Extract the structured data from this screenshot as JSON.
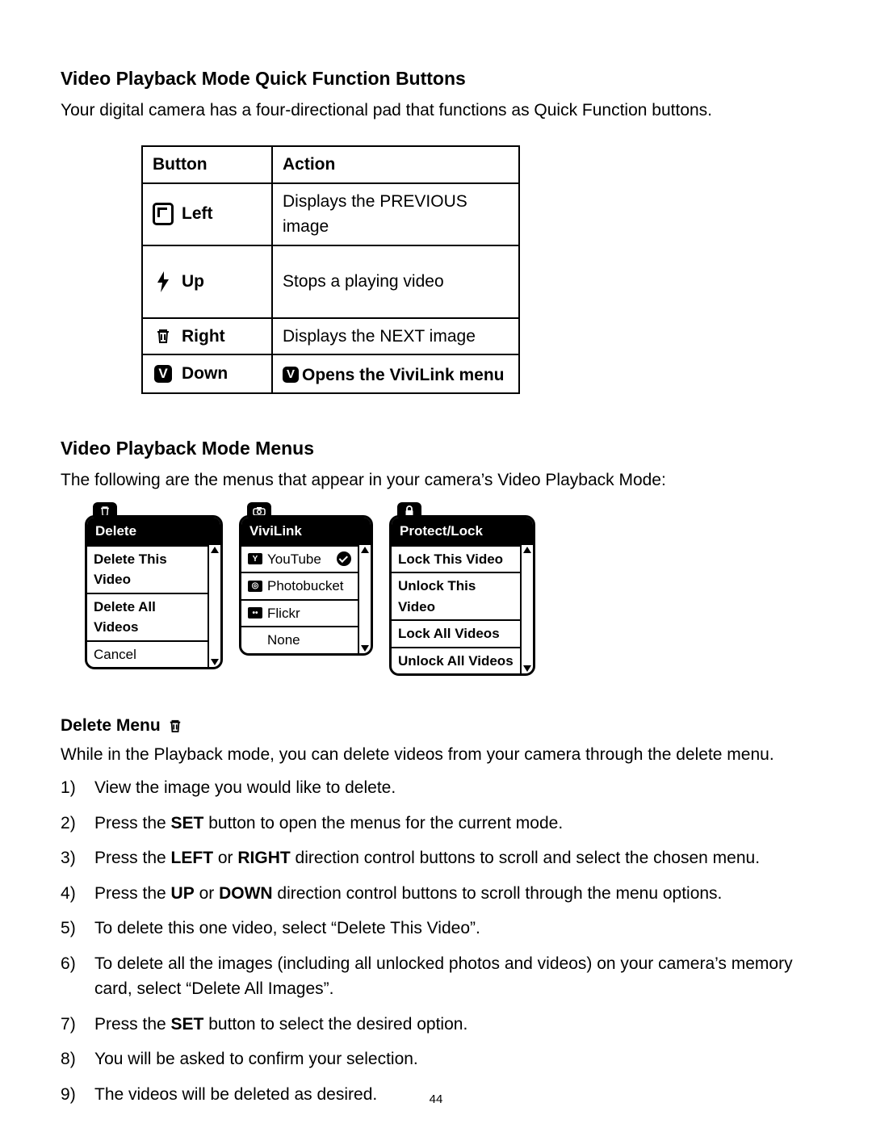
{
  "section1": {
    "title": "Video Playback Mode Quick Function Buttons",
    "intro": "Your digital camera has a four-directional pad that functions as Quick Function buttons.",
    "table": {
      "head_button": "Button",
      "head_action": "Action",
      "rows": [
        {
          "icon": "multi-frame-icon",
          "label": "Left",
          "action": "Displays the PREVIOUS image",
          "bold_action": false,
          "action_icon": null
        },
        {
          "icon": "bolt-icon",
          "label": "Up",
          "action": "Stops a playing video",
          "bold_action": false,
          "action_icon": null
        },
        {
          "icon": "trash-icon",
          "label": "Right",
          "action": "Displays the NEXT image",
          "bold_action": false,
          "action_icon": null
        },
        {
          "icon": "vivilink-v-icon",
          "label": "Down",
          "action": "Opens the ViviLink menu",
          "bold_action": true,
          "action_icon": "vivilink-v-icon"
        }
      ]
    }
  },
  "section2": {
    "title": "Video Playback Mode Menus",
    "intro": "The following are the menus that appear in your camera’s Video Playback Mode:",
    "menus": {
      "delete": {
        "tab_icon": "trash-icon",
        "header": "Delete",
        "items": [
          {
            "label": "Delete This Video",
            "bold": true
          },
          {
            "label": "Delete All Videos",
            "bold": true
          },
          {
            "label": "Cancel",
            "bold": false
          }
        ]
      },
      "vivilink": {
        "tab_icon": "camera-icon",
        "header": "ViviLink",
        "items": [
          {
            "icon": "youtube-icon",
            "label": "YouTube",
            "checked": true
          },
          {
            "icon": "photobucket-icon",
            "label": "Photobucket",
            "checked": false
          },
          {
            "icon": "flickr-icon",
            "label": "Flickr",
            "checked": false
          },
          {
            "icon": null,
            "label": "None",
            "checked": false
          }
        ]
      },
      "protect": {
        "tab_icon": "lock-icon",
        "header": "Protect/Lock",
        "items": [
          {
            "label": "Lock This Video"
          },
          {
            "label": "Unlock This Video"
          },
          {
            "label": "Lock All Videos"
          },
          {
            "label": "Unlock All Videos"
          }
        ]
      }
    }
  },
  "section3": {
    "title": "Delete Menu",
    "icon": "trash-icon",
    "intro": "While in the Playback mode, you can delete videos from your camera through the delete menu.",
    "steps": [
      [
        {
          "t": "View the image you would like to delete."
        }
      ],
      [
        {
          "t": "Press the "
        },
        {
          "b": "SET"
        },
        {
          "t": " button to open the menus for the current mode."
        }
      ],
      [
        {
          "t": "Press the "
        },
        {
          "b": "LEFT"
        },
        {
          "t": " or "
        },
        {
          "b": "RIGHT"
        },
        {
          "t": " direction control buttons to scroll and select the chosen menu."
        }
      ],
      [
        {
          "t": "Press the "
        },
        {
          "b": "UP"
        },
        {
          "t": " or "
        },
        {
          "b": "DOWN"
        },
        {
          "t": " direction control buttons to scroll through the menu options."
        }
      ],
      [
        {
          "t": "To delete this one video, select “Delete This Video”."
        }
      ],
      [
        {
          "t": "To delete all the images (including all unlocked photos and videos) on your camera’s memory card, select “Delete All Images”."
        }
      ],
      [
        {
          "t": "Press the "
        },
        {
          "b": "SET"
        },
        {
          "t": " button to select the desired option."
        }
      ],
      [
        {
          "t": "You will be asked to confirm your selection."
        }
      ],
      [
        {
          "t": "The videos will be deleted as desired."
        }
      ]
    ]
  },
  "page_number": "44"
}
